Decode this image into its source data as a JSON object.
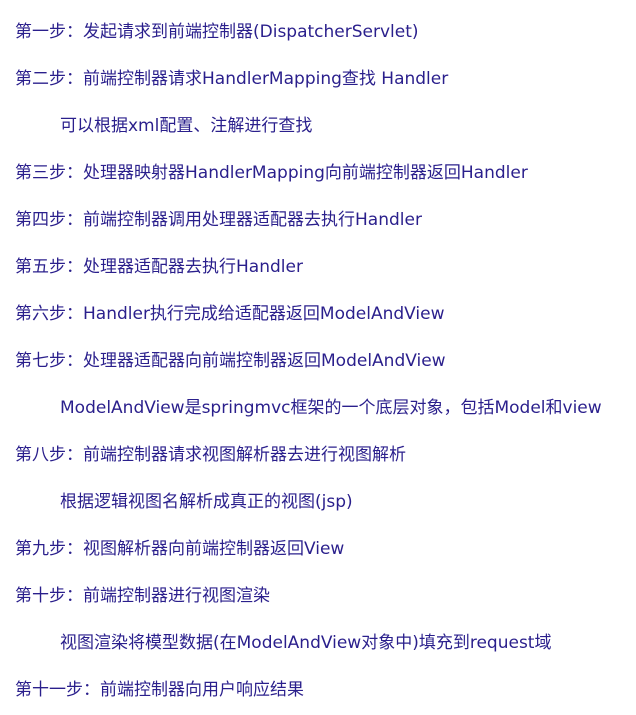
{
  "steps": [
    "第一步：发起请求到前端控制器(DispatcherServlet)",
    "第二步：前端控制器请求HandlerMapping查找 Handler",
    "可以根据xml配置、注解进行查找",
    "第三步：处理器映射器HandlerMapping向前端控制器返回Handler",
    "第四步：前端控制器调用处理器适配器去执行Handler",
    "第五步：处理器适配器去执行Handler",
    "第六步：Handler执行完成给适配器返回ModelAndView",
    "第七步：处理器适配器向前端控制器返回ModelAndView",
    "ModelAndView是springmvc框架的一个底层对象，包括Model和view",
    "第八步：前端控制器请求视图解析器去进行视图解析",
    "根据逻辑视图名解析成真正的视图(jsp)",
    "第九步：视图解析器向前端控制器返回View",
    "第十步：前端控制器进行视图渲染",
    "视图渲染将模型数据(在ModelAndView对象中)填充到request域",
    "第十一步：前端控制器向用户响应结果"
  ]
}
